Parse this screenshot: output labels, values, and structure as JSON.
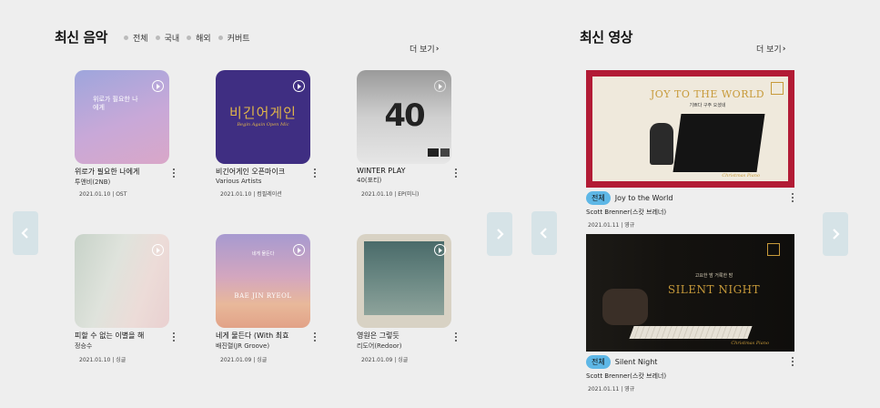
{
  "music": {
    "title": "최신 음악",
    "filters": [
      "전체",
      "국내",
      "해외",
      "커버트"
    ],
    "more": "더 보기",
    "items": [
      {
        "title": "위로가 필요한 나에게",
        "artist": "투앤비(2NB)",
        "meta": "2021.01.10 | OST",
        "cover_text": "위로가 필요한 나에게"
      },
      {
        "title": "비긴어게인 오픈마이크",
        "artist": "Various Artists",
        "meta": "2021.01.10 | 컴필레이션",
        "cover_text": "비긴어게인",
        "cover_sub": "Begin Again Open Mic"
      },
      {
        "title": "WINTER PLAY",
        "artist": "40(포티)",
        "meta": "2021.01.10 | EP(미니)",
        "cover_text": "40"
      },
      {
        "title": "피할 수 없는 이별을 해",
        "artist": "정승수",
        "meta": "2021.01.10 | 싱글",
        "cover_text": ""
      },
      {
        "title": "네게 물든다 (With 최효",
        "artist": "배진렬(JR Groove)",
        "meta": "2021.01.09 | 싱글",
        "cover_text": "BAE JIN RYEOL",
        "cover_sub": "네게 물든다"
      },
      {
        "title": "영원은 그렇듯",
        "artist": "리도어(Redoor)",
        "meta": "2021.01.09 | 싱글",
        "cover_text": ""
      }
    ]
  },
  "video": {
    "title": "최신 영상",
    "more": "더 보기",
    "items": [
      {
        "badge": "전체",
        "title": "Joy to the World",
        "artist": "Scott Brenner(스캇 브레너)",
        "meta": "2021.01.11 | 영규",
        "thumb_text": "JOY TO THE WORLD",
        "thumb_sub": "기쁘다 구주 오셨네",
        "thumb_caption": "Christmas Piano"
      },
      {
        "badge": "전체",
        "title": "Silent Night",
        "artist": "Scott Brenner(스캇 브레너)",
        "meta": "2021.01.11 | 영규",
        "thumb_text": "SILENT NIGHT",
        "thumb_sub": "고요한 밤 거룩한 밤",
        "thumb_caption": "Christmas Piano"
      }
    ]
  },
  "colors": {
    "accent": "#5eb7e6",
    "arrow_bg": "#d6e3e7",
    "video1_frame": "#b21b35"
  }
}
